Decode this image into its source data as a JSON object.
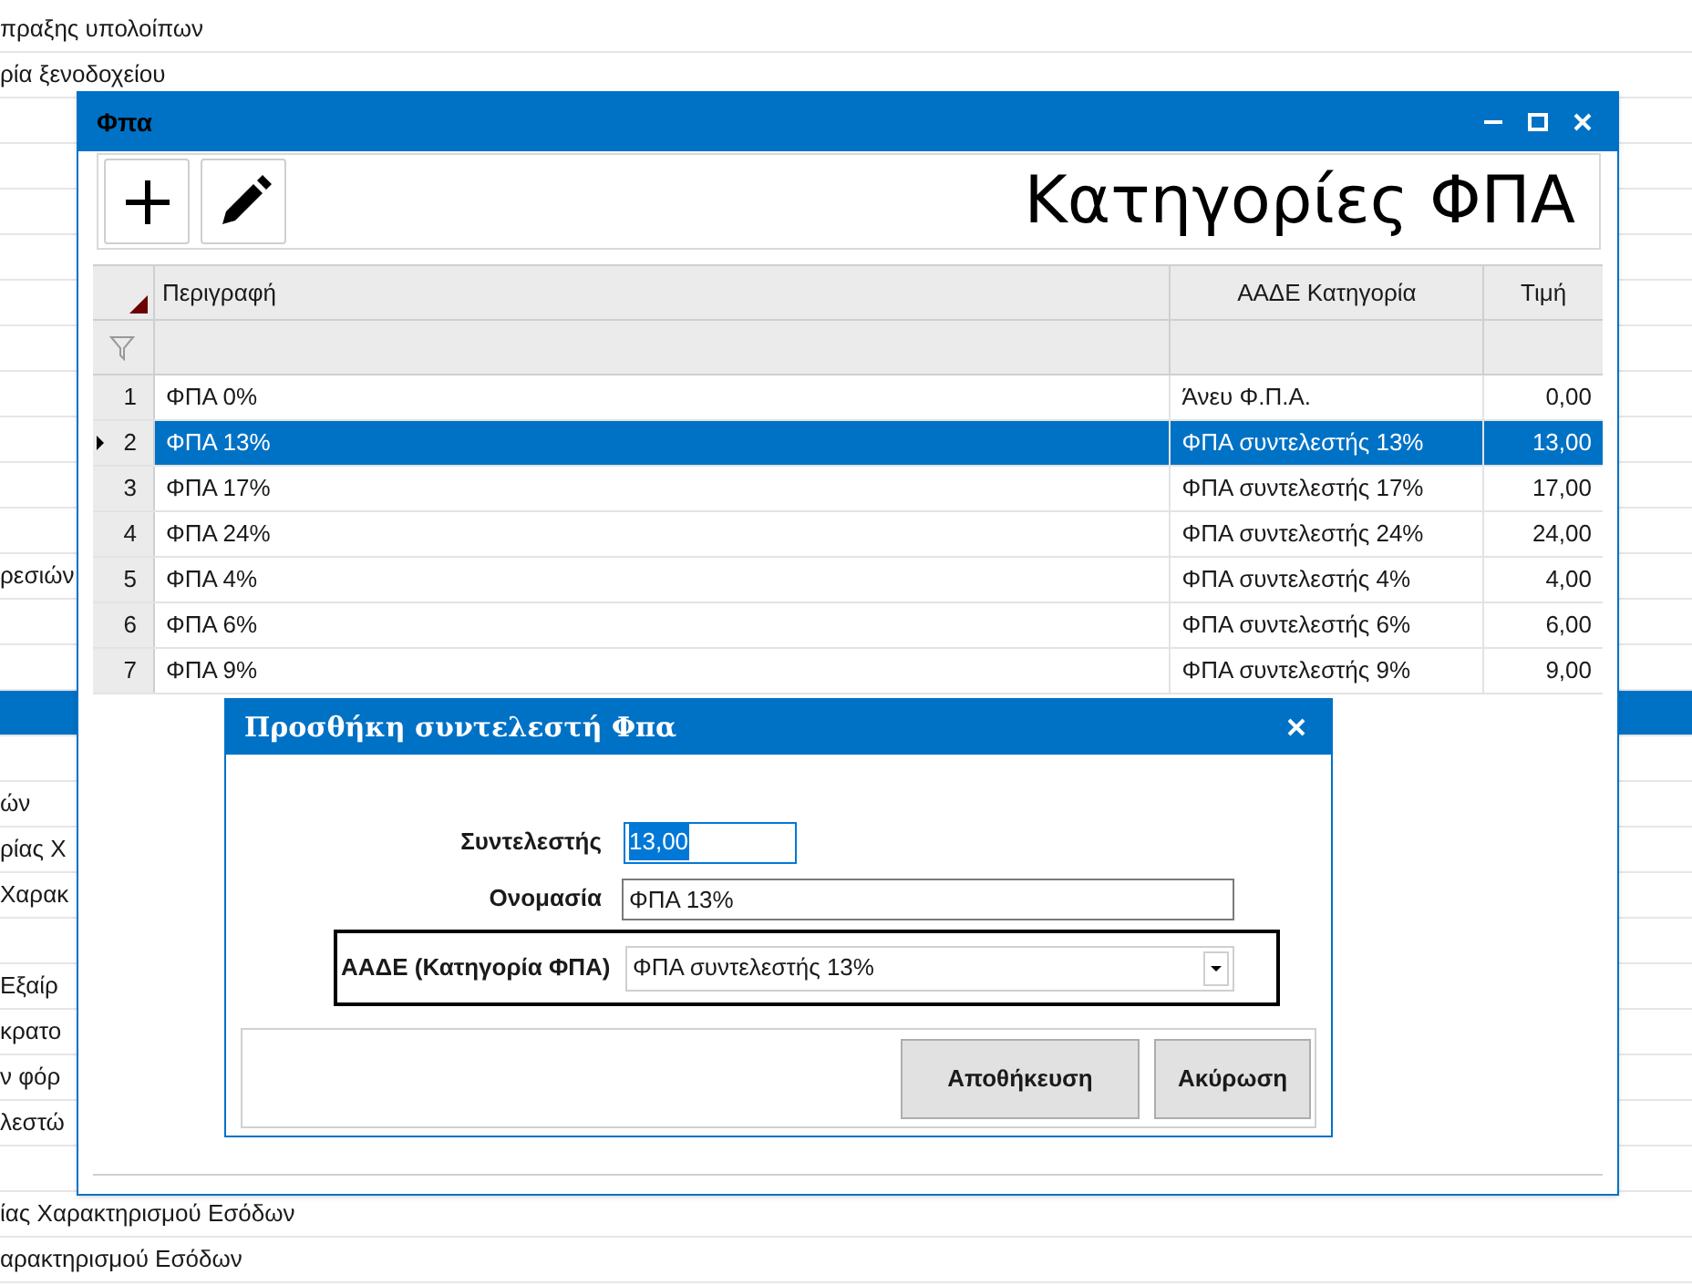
{
  "background_list": {
    "rows": [
      {
        "text": "πραξης υπολοίπων",
        "selected": false
      },
      {
        "text": "ρία ξενοδοχείου",
        "selected": false
      },
      {
        "selected": false
      },
      {
        "selected": false
      },
      {
        "selected": false
      },
      {
        "selected": false
      },
      {
        "selected": false
      },
      {
        "selected": false
      },
      {
        "selected": false
      },
      {
        "selected": false
      },
      {
        "selected": false
      },
      {
        "selected": false
      },
      {
        "text": "ρεσιών",
        "selected": false
      },
      {
        "selected": false
      },
      {
        "selected": false
      },
      {
        "selected": true
      },
      {
        "selected": false
      },
      {
        "text": "ών",
        "selected": false
      },
      {
        "text": "ρίας Χ",
        "selected": false
      },
      {
        "text": "Χαρακ",
        "selected": false
      },
      {
        "selected": false
      },
      {
        "text": " Εξαίρ",
        "selected": false
      },
      {
        "text": "κρατο",
        "selected": false
      },
      {
        "text": "ν φόρ",
        "selected": false
      },
      {
        "text": "λεστώ",
        "selected": false
      },
      {
        "selected": false
      },
      {
        "text": "ίας Χαρακτηρισμού Εσόδων",
        "selected": false
      },
      {
        "text": "αρακτηρισμού Εσόδων",
        "selected": false
      }
    ]
  },
  "window": {
    "title": "Φπα",
    "heading": "Κατηγορίες ΦΠΑ",
    "table": {
      "columns": [
        "Περιγραφή",
        "ΑΑΔΕ Κατηγορία",
        "Τιμή"
      ],
      "rows": [
        {
          "number": "1",
          "description": "ΦΠΑ 0%",
          "category": "Άνευ Φ.Π.Α.",
          "value": "0,00",
          "selected": false
        },
        {
          "number": "2",
          "description": "ΦΠΑ 13%",
          "category": "ΦΠΑ συντελεστής 13%",
          "value": "13,00",
          "selected": true
        },
        {
          "number": "3",
          "description": "ΦΠΑ 17%",
          "category": "ΦΠΑ συντελεστής 17%",
          "value": "17,00",
          "selected": false
        },
        {
          "number": "4",
          "description": "ΦΠΑ 24%",
          "category": "ΦΠΑ συντελεστής 24%",
          "value": "24,00",
          "selected": false
        },
        {
          "number": "5",
          "description": "ΦΠΑ 4%",
          "category": "ΦΠΑ συντελεστής 4%",
          "value": "4,00",
          "selected": false
        },
        {
          "number": "6",
          "description": "ΦΠΑ 6%",
          "category": "ΦΠΑ συντελεστής 6%",
          "value": "6,00",
          "selected": false
        },
        {
          "number": "7",
          "description": "ΦΠΑ 9%",
          "category": "ΦΠΑ συντελεστής 9%",
          "value": "9,00",
          "selected": false
        }
      ]
    }
  },
  "dialog": {
    "title": "Προσθήκη συντελεστή Φπα",
    "rate": {
      "label": "Συντελεστής",
      "value": "13,00"
    },
    "name": {
      "label": "Ονομασία",
      "value": "ΦΠΑ 13%"
    },
    "category": {
      "label": "ΑΑΔΕ (Κατηγορία ΦΠΑ)",
      "value": "ΦΠΑ συντελεστής 13%"
    },
    "buttons": [
      "Αποθήκευση",
      "Ακύρωση"
    ]
  }
}
